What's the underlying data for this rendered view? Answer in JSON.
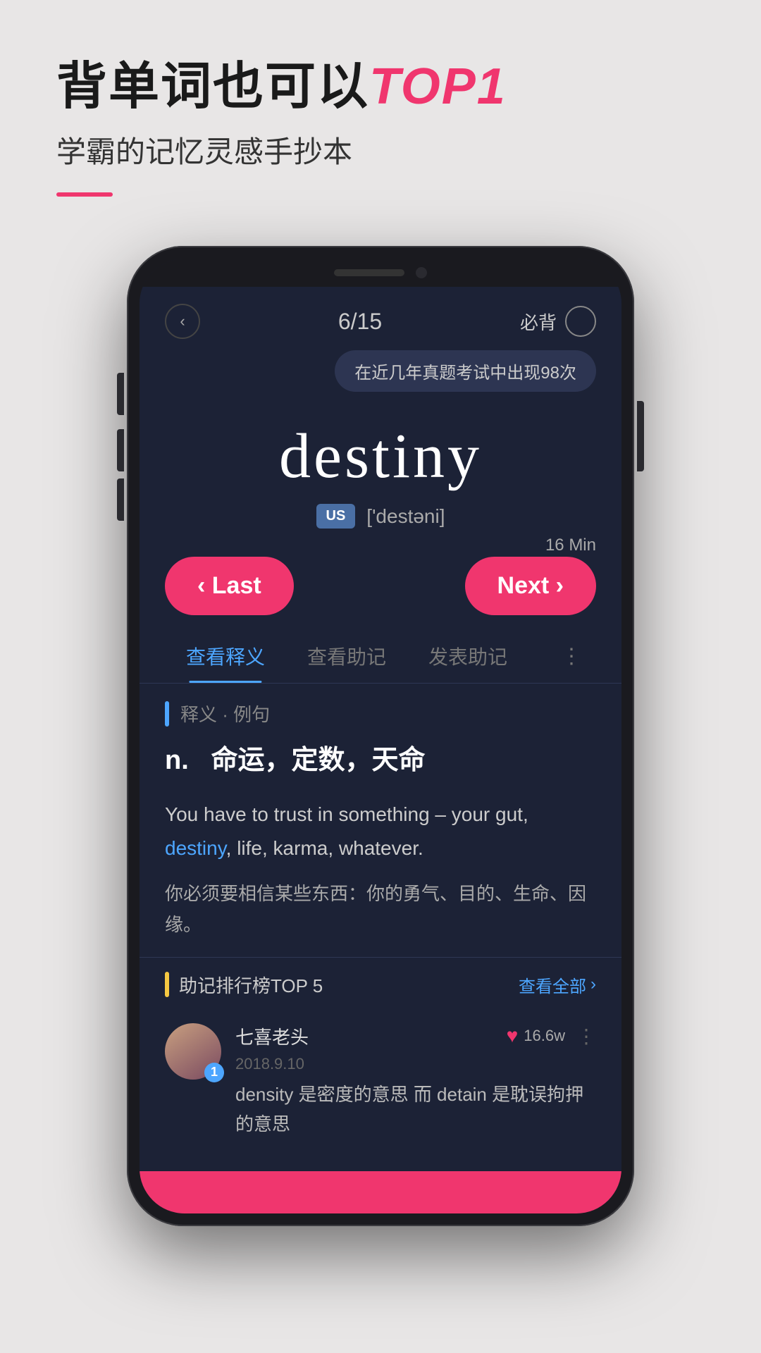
{
  "header": {
    "main_title_part1": "背单词也可以",
    "main_title_highlight": "TOP1",
    "sub_title": "学霸的记忆灵感手抄本"
  },
  "phone": {
    "nav": {
      "back_icon": "‹",
      "progress": "6/15",
      "bookmark_label": "必背"
    },
    "tooltip": "在近几年真题考试中出现98次",
    "word": {
      "text": "destiny",
      "phonetic_badge": "US",
      "phonetic": "['destəni]"
    },
    "time_label": "16 Min",
    "buttons": {
      "last": "‹ Last",
      "next": "Next ›"
    },
    "tabs": [
      {
        "label": "查看释义",
        "active": true
      },
      {
        "label": "查看助记",
        "active": false
      },
      {
        "label": "发表助记",
        "active": false
      }
    ],
    "more_icon": "⋮",
    "definition_section": {
      "label": "释义 · 例句",
      "part_of_speech": "n.",
      "definition_zh": "命运，定数，天命",
      "example_en_before": "You have to trust in something – your gut, ",
      "example_en_word": "destiny",
      "example_en_after": ", life, karma, whatever.",
      "example_zh": "你必须要相信某些东西：你的勇气、目的、生命、因缘。"
    },
    "ranking_section": {
      "title": "助记排行榜TOP 5",
      "view_all": "查看全部",
      "entries": [
        {
          "rank": "1",
          "name": "七喜老头",
          "date": "2018.9.10",
          "likes": "16.6w",
          "text": "density 是密度的意思 而 detain 是耽误拘押的意思"
        }
      ]
    }
  }
}
